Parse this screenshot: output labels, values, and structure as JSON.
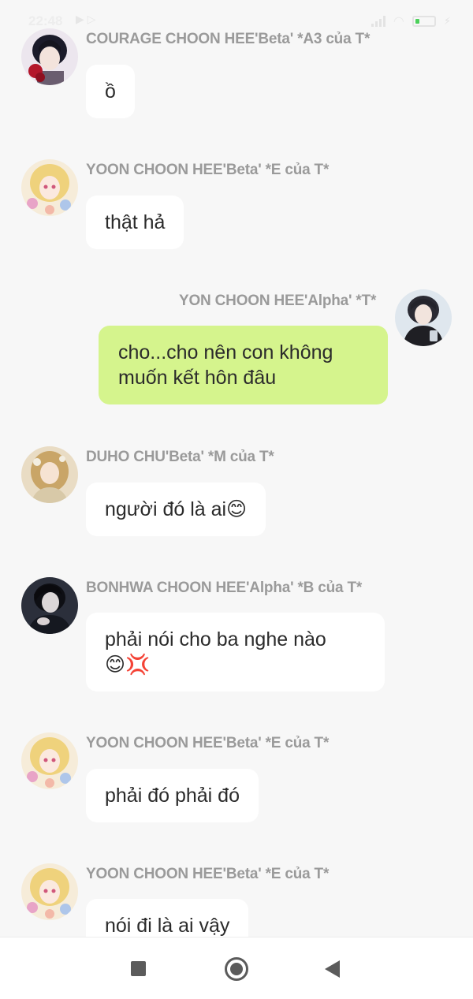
{
  "status_bar": {
    "time": "22:48",
    "icons": [
      "play-icon",
      "signal-icon",
      "wifi-icon",
      "battery-icon",
      "charging-icon"
    ]
  },
  "messages": [
    {
      "sender": "COURAGE CHOON HEE'Beta' *A3 của T*",
      "text": "ồ",
      "mine": false,
      "avatar": "dark-hair-rose-avatar"
    },
    {
      "sender": "YOON CHOON HEE'Beta' *E của T*",
      "text": "thật hả",
      "mine": false,
      "avatar": "blonde-flower-avatar"
    },
    {
      "sender": "YON CHOON HEE'Alpha' *T*",
      "text": "cho...cho nên con không\nmuốn kết hôn đâu",
      "mine": true,
      "avatar": "dark-hair-hoodie-avatar"
    },
    {
      "sender": "DUHO CHU'Beta' *M của T*",
      "text": "người đó là ai😊",
      "mine": false,
      "avatar": "golden-hair-avatar"
    },
    {
      "sender": "BONHWA CHOON HEE'Alpha' *B của T*",
      "text": "phải nói cho ba nghe nào\n😊💢",
      "mine": false,
      "avatar": "dark-suit-avatar"
    },
    {
      "sender": "YOON CHOON HEE'Beta' *E của T*",
      "text": "phải đó phải đó",
      "mine": false,
      "avatar": "blonde-flower-avatar"
    },
    {
      "sender": "YOON CHOON HEE'Beta' *E của T*",
      "text": "nói đi là ai vậy",
      "mine": false,
      "avatar": "blonde-flower-avatar"
    }
  ],
  "navbar": {
    "recents": "recents-square-icon",
    "home": "home-circle-icon",
    "back": "back-triangle-icon"
  }
}
